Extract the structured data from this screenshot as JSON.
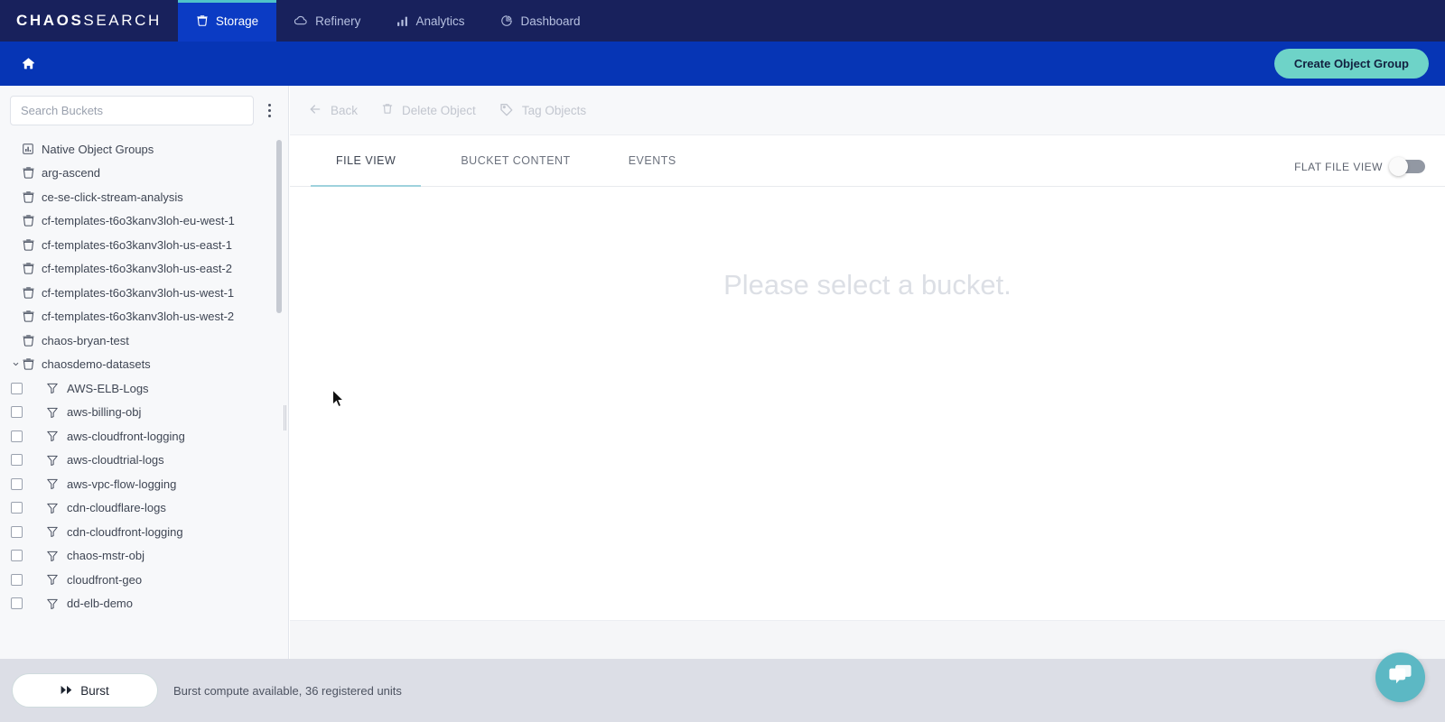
{
  "brand": {
    "bold": "CHAOS",
    "light": "SEARCH"
  },
  "topnav": {
    "items": [
      {
        "label": "Storage",
        "icon": "bucket-icon",
        "active": true
      },
      {
        "label": "Refinery",
        "icon": "cloud-icon",
        "active": false
      },
      {
        "label": "Analytics",
        "icon": "bar-chart-icon",
        "active": false
      },
      {
        "label": "Dashboard",
        "icon": "pie-chart-icon",
        "active": false
      }
    ]
  },
  "subbar": {
    "home_icon": "home-icon",
    "create_button": "Create Object Group"
  },
  "sidebar": {
    "search": {
      "placeholder": "Search Buckets",
      "value": ""
    },
    "kebab_icon": "more-vertical-icon",
    "items": [
      {
        "label": "Native Object Groups",
        "icon": "chart-square-icon",
        "type": "root",
        "expandable": false
      },
      {
        "label": "arg-ascend",
        "icon": "bucket-icon",
        "type": "root",
        "expandable": false
      },
      {
        "label": "ce-se-click-stream-analysis",
        "icon": "bucket-icon",
        "type": "root",
        "expandable": false
      },
      {
        "label": "cf-templates-t6o3kanv3loh-eu-west-1",
        "icon": "bucket-icon",
        "type": "root",
        "expandable": false
      },
      {
        "label": "cf-templates-t6o3kanv3loh-us-east-1",
        "icon": "bucket-icon",
        "type": "root",
        "expandable": false
      },
      {
        "label": "cf-templates-t6o3kanv3loh-us-east-2",
        "icon": "bucket-icon",
        "type": "root",
        "expandable": false
      },
      {
        "label": "cf-templates-t6o3kanv3loh-us-west-1",
        "icon": "bucket-icon",
        "type": "root",
        "expandable": false
      },
      {
        "label": "cf-templates-t6o3kanv3loh-us-west-2",
        "icon": "bucket-icon",
        "type": "root",
        "expandable": false
      },
      {
        "label": "chaos-bryan-test",
        "icon": "bucket-icon",
        "type": "root",
        "expandable": false
      },
      {
        "label": "chaosdemo-datasets",
        "icon": "bucket-icon",
        "type": "root",
        "expandable": true,
        "expanded": true
      },
      {
        "label": "AWS-ELB-Logs",
        "icon": "filter-icon",
        "type": "child",
        "checked": false
      },
      {
        "label": "aws-billing-obj",
        "icon": "filter-icon",
        "type": "child",
        "checked": false
      },
      {
        "label": "aws-cloudfront-logging",
        "icon": "filter-icon",
        "type": "child",
        "checked": false
      },
      {
        "label": "aws-cloudtrial-logs",
        "icon": "filter-icon",
        "type": "child",
        "checked": false
      },
      {
        "label": "aws-vpc-flow-logging",
        "icon": "filter-icon",
        "type": "child",
        "checked": false
      },
      {
        "label": "cdn-cloudflare-logs",
        "icon": "filter-icon",
        "type": "child",
        "checked": false
      },
      {
        "label": "cdn-cloudfront-logging",
        "icon": "filter-icon",
        "type": "child",
        "checked": false
      },
      {
        "label": "chaos-mstr-obj",
        "icon": "filter-icon",
        "type": "child",
        "checked": false
      },
      {
        "label": "cloudfront-geo",
        "icon": "filter-icon",
        "type": "child",
        "checked": false
      },
      {
        "label": "dd-elb-demo",
        "icon": "filter-icon",
        "type": "child",
        "checked": false
      }
    ]
  },
  "main": {
    "toolbar": [
      {
        "label": "Back",
        "icon": "arrow-left-icon",
        "disabled": true
      },
      {
        "label": "Delete Object",
        "icon": "trash-icon",
        "disabled": true
      },
      {
        "label": "Tag Objects",
        "icon": "tag-icon",
        "disabled": true
      }
    ],
    "tabs": [
      {
        "label": "FILE VIEW",
        "active": true
      },
      {
        "label": "BUCKET CONTENT",
        "active": false
      },
      {
        "label": "EVENTS",
        "active": false
      }
    ],
    "flat_file_view": {
      "label": "FLAT FILE VIEW",
      "enabled": false
    },
    "empty_message": "Please select a bucket."
  },
  "bottombar": {
    "burst_button": "Burst",
    "burst_icon": "fast-forward-icon",
    "status": "Burst compute available, 36 registered units"
  },
  "chat": {
    "icon": "chat-bubble-icon"
  },
  "colors": {
    "nav_navy": "#18215c",
    "subbar_blue": "#0635b5",
    "active_tab_blue": "#0b3bc4",
    "accent_teal": "#6ed3c8",
    "tab_underline": "#9ed2dd",
    "chat_teal": "#5cb8c4",
    "bottombar_gray": "#dcdee6"
  }
}
